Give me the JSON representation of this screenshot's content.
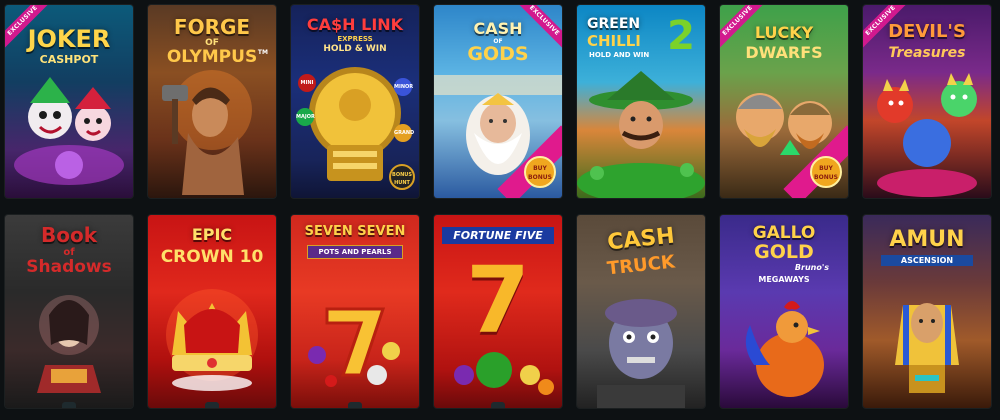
{
  "games": [
    {
      "title": "JOKER",
      "subtitle": "CASHPOT",
      "exclusive": "EXCLUSIVE"
    },
    {
      "title": "FORGE",
      "subtitle_of": "OF",
      "subtitle": "OLYMPUS",
      "mark": "TM"
    },
    {
      "title": "CA$H LINK",
      "subtitle": "EXPRESS",
      "tagline": "HOLD & WIN",
      "coins": [
        "MINI",
        "MINOR",
        "MAJOR",
        "GRAND"
      ],
      "badge": "BONUS HUNT"
    },
    {
      "title": "CASH",
      "subtitle_of": "OF",
      "subtitle": "GODS",
      "exclusive": "EXCLUSIVE",
      "badge": "BUY BONUS"
    },
    {
      "title": "GREEN",
      "subtitle": "CHILLI",
      "number": "2",
      "tagline": "HOLD AND WIN"
    },
    {
      "title": "LUCKY",
      "subtitle": "DWARFS",
      "exclusive": "EXCLUSIVE",
      "badge": "BUY BONUS"
    },
    {
      "title": "DEVIL'S",
      "subtitle": "Treasures",
      "exclusive": "EXCLUSIVE"
    },
    {
      "title": "Book",
      "subtitle_of": "of",
      "subtitle": "Shadows"
    },
    {
      "title": "EPIC",
      "subtitle": "CROWN 10"
    },
    {
      "title": "SEVEN SEVEN",
      "subtitle": "POTS AND PEARLS"
    },
    {
      "title": "FORTUNE FIVE",
      "subtitle": "7"
    },
    {
      "title": "CASH",
      "subtitle": "TRUCK"
    },
    {
      "title": "GALLO",
      "subtitle": "GOLD",
      "tagline": "Bruno's",
      "extra": "MEGAWAYS"
    },
    {
      "title": "AMUN",
      "subtitle": "ASCENSION"
    }
  ],
  "colors": {
    "background": "#0d1113",
    "exclusive": "#d2198e",
    "gold": "#f7c531"
  }
}
